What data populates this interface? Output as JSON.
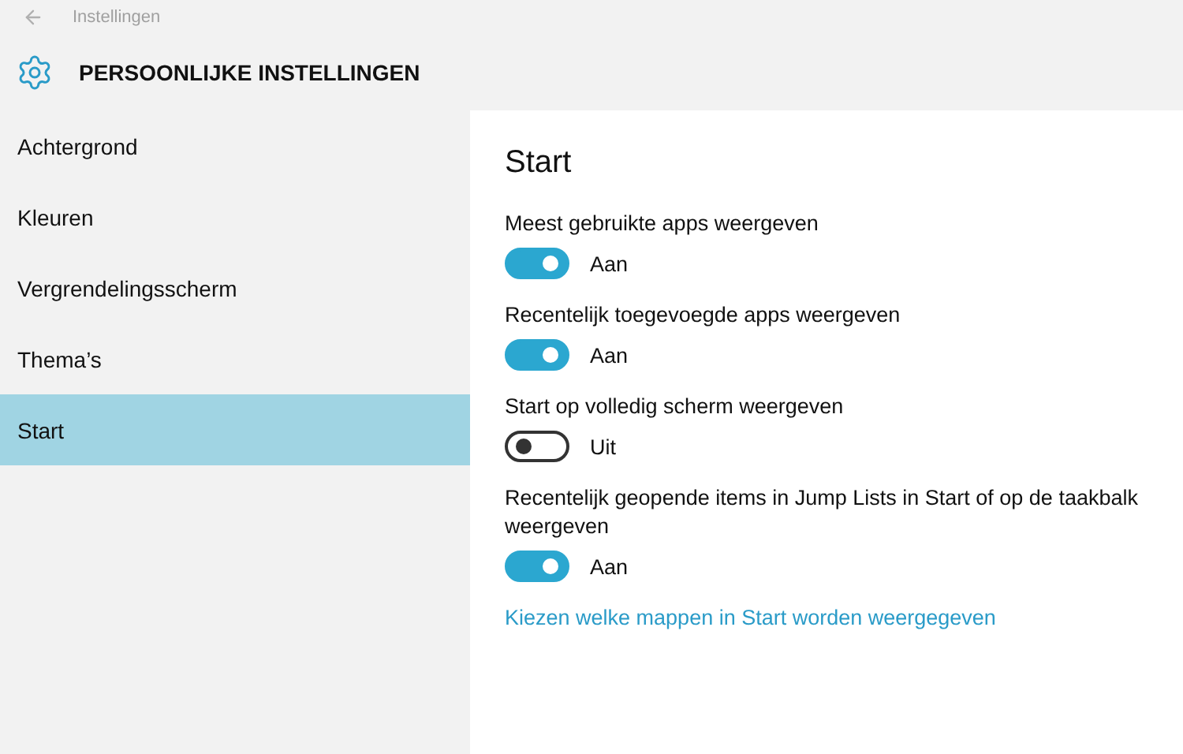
{
  "window": {
    "title": "Instellingen"
  },
  "header": {
    "title": "PERSOONLIJKE INSTELLINGEN"
  },
  "sidebar": {
    "items": [
      {
        "label": "Achtergrond",
        "selected": false
      },
      {
        "label": "Kleuren",
        "selected": false
      },
      {
        "label": "Vergrendelingsscherm",
        "selected": false
      },
      {
        "label": "Thema’s",
        "selected": false
      },
      {
        "label": "Start",
        "selected": true
      }
    ]
  },
  "content": {
    "title": "Start",
    "settings": [
      {
        "label": "Meest gebruikte apps weergeven",
        "on": true,
        "state_text": "Aan"
      },
      {
        "label": "Recentelijk toegevoegde apps weergeven",
        "on": true,
        "state_text": "Aan"
      },
      {
        "label": "Start op volledig scherm weergeven",
        "on": false,
        "state_text": "Uit"
      },
      {
        "label": "Recentelijk geopende items in Jump Lists in Start of op de taakbalk weergeven",
        "on": true,
        "state_text": "Aan"
      }
    ],
    "link": "Kiezen welke mappen in Start worden weergegeven"
  }
}
